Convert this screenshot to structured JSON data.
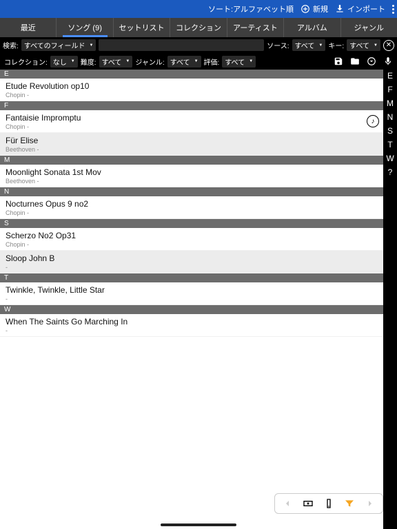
{
  "topBar": {
    "sort": "ソート:アルファベット順",
    "new": "新規",
    "import": "インポート"
  },
  "tabs": [
    {
      "label": "最近"
    },
    {
      "label": "ソング (9)",
      "active": true
    },
    {
      "label": "セットリスト"
    },
    {
      "label": "コレクション"
    },
    {
      "label": "アーティスト"
    },
    {
      "label": "アルバム"
    },
    {
      "label": "ジャンル"
    }
  ],
  "filter1": {
    "searchLabel": "検索:",
    "fieldAll": "すべてのフィールド",
    "sourceLabel": "ソース:",
    "sourceAll": "すべて",
    "keyLabel": "キー:",
    "keyAll": "すべて"
  },
  "filter2": {
    "collectionLabel": "コレクション:",
    "collectionNone": "なし",
    "difficultyLabel": "難度:",
    "difficultyAll": "すべて",
    "genreLabel": "ジャンル:",
    "genreAll": "すべて",
    "ratingLabel": "評価:",
    "ratingAll": "すべて"
  },
  "sections": [
    {
      "letter": "E",
      "songs": [
        {
          "title": "Etude Revolution op10",
          "artist": "Chopin -",
          "alt": false
        }
      ]
    },
    {
      "letter": "F",
      "songs": [
        {
          "title": "Fantaisie Impromptu",
          "artist": "Chopin -",
          "alt": false,
          "disc": true
        },
        {
          "title": "Für Elise",
          "artist": "Beethoven -",
          "alt": true
        }
      ]
    },
    {
      "letter": "M",
      "songs": [
        {
          "title": "Moonlight Sonata 1st Mov",
          "artist": "Beethoven -",
          "alt": false
        }
      ]
    },
    {
      "letter": "N",
      "songs": [
        {
          "title": "Nocturnes Opus 9 no2",
          "artist": "Chopin -",
          "alt": false
        }
      ]
    },
    {
      "letter": "S",
      "songs": [
        {
          "title": "Scherzo No2 Op31",
          "artist": "Chopin -",
          "alt": false
        },
        {
          "title": "Sloop John B",
          "artist": "-",
          "alt": true
        }
      ]
    },
    {
      "letter": "T",
      "songs": [
        {
          "title": "Twinkle, Twinkle, Little Star",
          "artist": "-",
          "alt": false
        }
      ]
    },
    {
      "letter": "W",
      "songs": [
        {
          "title": "When The Saints Go Marching In",
          "artist": "-",
          "alt": false
        }
      ]
    }
  ],
  "azIndex": [
    "E",
    "F",
    "M",
    "N",
    "S",
    "T",
    "W",
    "?"
  ]
}
